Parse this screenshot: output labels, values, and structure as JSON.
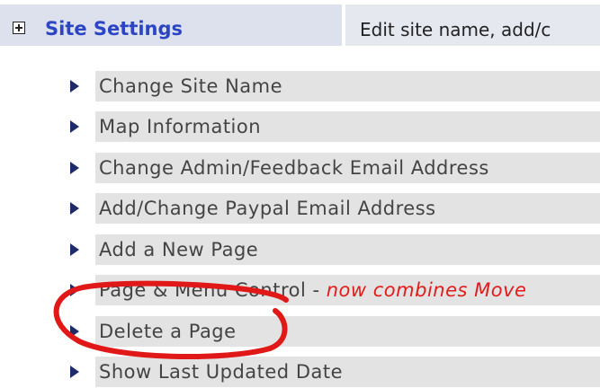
{
  "header": {
    "expand_icon": "plus-box-icon",
    "title": "Site Settings",
    "description": "Edit site name, add/c",
    "title_color": "#2b45c4"
  },
  "menu": {
    "items": [
      {
        "label": "Change Site Name"
      },
      {
        "label": "Map Information"
      },
      {
        "label": "Change Admin/Feedback Email Address"
      },
      {
        "label": "Add/Change Paypal Email Address"
      },
      {
        "label": "Add a New Page"
      },
      {
        "label": "Page & Menu Control",
        "separator": " - ",
        "note": "now combines Move"
      },
      {
        "label": "Delete a Page"
      },
      {
        "label": "Show Last Updated Date"
      }
    ],
    "arrow_color": "#1d2b6b",
    "note_color": "#e21b1b"
  },
  "annotation": {
    "shape": "hand-drawn-red-circle",
    "color": "#e01818"
  }
}
